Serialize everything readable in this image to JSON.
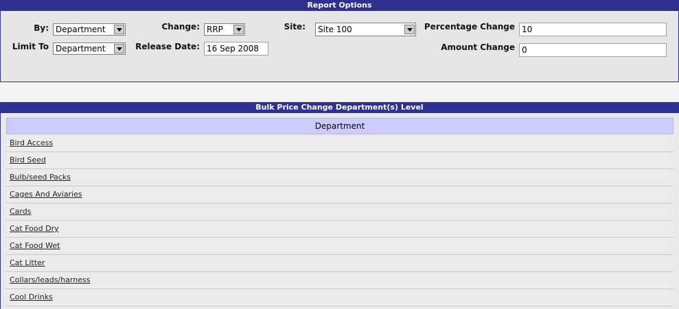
{
  "report_options": {
    "title": "Report Options",
    "by_label": "By:",
    "by_value": "Department",
    "limit_label": "Limit To",
    "limit_value": "Department",
    "change_label": "Change:",
    "change_value": "RRP",
    "release_label": "Release Date:",
    "release_value": "16 Sep 2008",
    "site_label": "Site:",
    "site_value": "Site 100",
    "pct_label": "Percentage Change",
    "pct_value": "10",
    "amount_label": "Amount Change",
    "amount_value": "0"
  },
  "departments": {
    "title": "Bulk Price Change Department(s) Level",
    "column_header": "Department",
    "rows": [
      "Bird Access",
      "Bird Seed",
      "Bulb/seed Packs",
      "Cages And Aviaries",
      "Cards",
      "Cat Food Dry",
      "Cat Food Wet",
      "Cat Litter",
      "Collars/leads/harness",
      "Cool Drinks"
    ]
  }
}
